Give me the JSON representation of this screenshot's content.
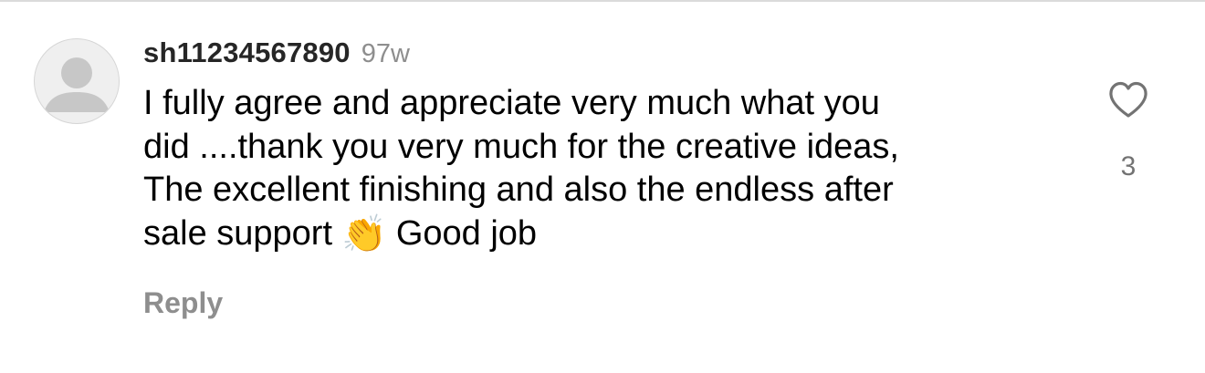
{
  "comment": {
    "username": "sh11234567890",
    "timestamp": "97w",
    "text_before_emoji": "I fully agree and appreciate very much what you\ndid ....thank you very much for the creative ideas,\nThe excellent finishing and also the endless after\nsale support",
    "emoji": "👏",
    "text_after_emoji": "Good job",
    "reply_label": "Reply",
    "like_count": "3",
    "icons": {
      "avatar": "default-avatar-icon",
      "like": "heart-outline-icon"
    },
    "colors": {
      "username": "#262626",
      "meta": "#8e8e8e",
      "like_count": "#737373",
      "avatar_bg": "#efefef",
      "avatar_figure": "#c7c7c7"
    }
  }
}
